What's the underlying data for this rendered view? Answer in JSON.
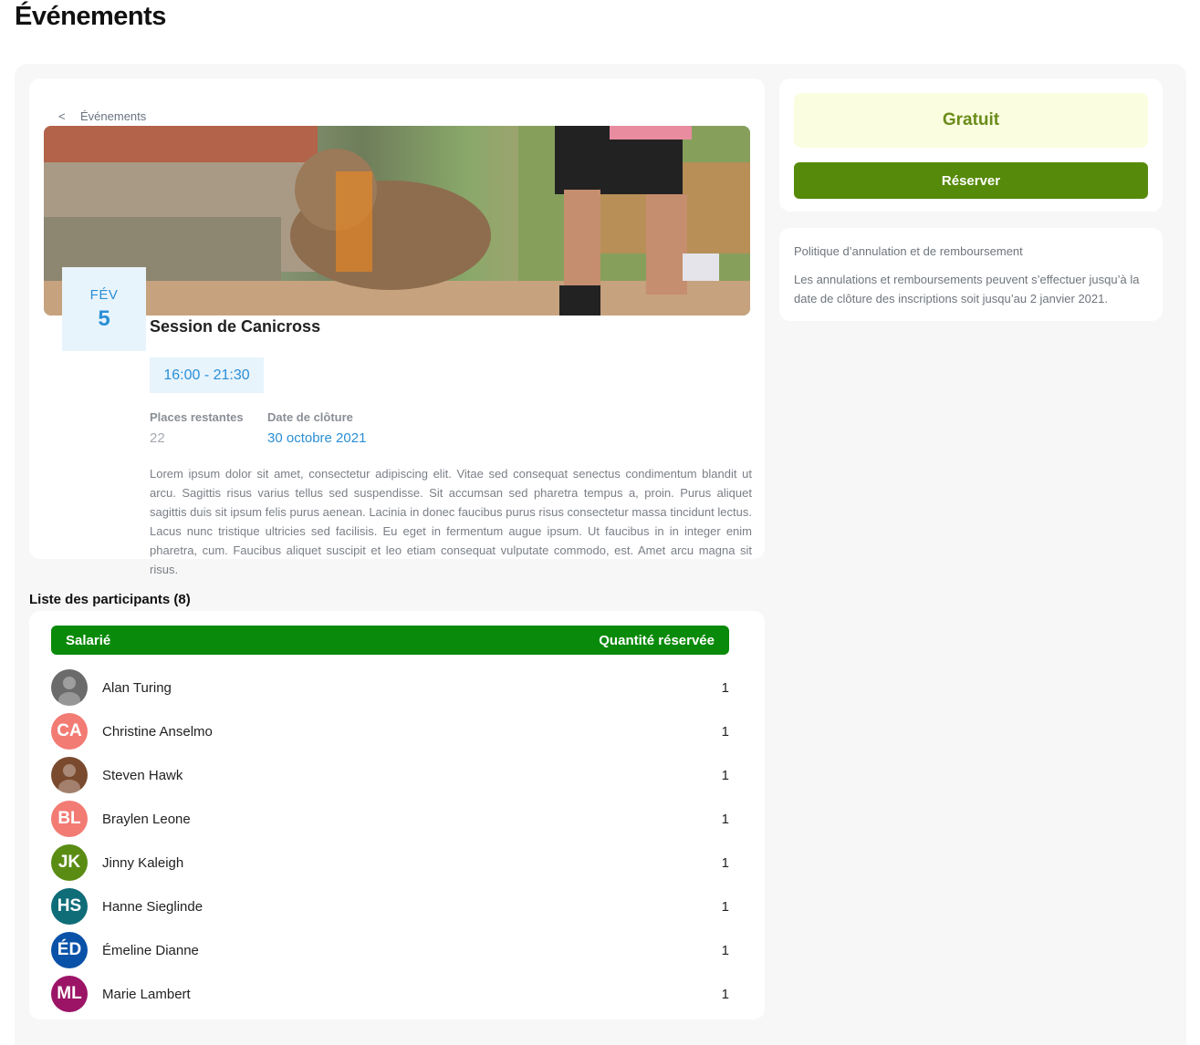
{
  "page": {
    "title": "Événements"
  },
  "breadcrumb": {
    "back_label": "Événements"
  },
  "event": {
    "date_month": "FÉV",
    "date_day": "5",
    "title": "Session de Canicross",
    "time": "16:00 - 21:30",
    "places_label": "Places restantes",
    "places_value": "22",
    "closing_label": "Date de clôture",
    "closing_value": "30 octobre 2021",
    "description": "Lorem ipsum dolor sit amet, consectetur adipiscing elit. Vitae sed consequat senectus condimentum blandit ut arcu. Sagittis risus varius tellus sed suspendisse. Sit accumsan sed pharetra tempus a, proin. Purus aliquet sagittis duis sit ipsum felis purus aenean. Lacinia in donec faucibus purus risus consectetur massa tincidunt lectus. Lacus nunc tristique ultricies sed facilisis. Eu eget in fermentum augue ipsum. Ut faucibus in in integer enim pharetra, cum. Faucibus aliquet suscipit et leo etiam consequat vulputate commodo, est. Amet arcu magna sit risus."
  },
  "participants": {
    "heading": "Liste des participants (8)",
    "col_employee": "Salarié",
    "col_quantity": "Quantité réservée",
    "rows": [
      {
        "name": "Alan Turing",
        "initials": "",
        "color": "#6b6b6b",
        "photo": true,
        "quantity": "1"
      },
      {
        "name": "Christine Anselmo",
        "initials": "CA",
        "color": "#f27b74",
        "photo": false,
        "quantity": "1"
      },
      {
        "name": "Steven Hawk",
        "initials": "",
        "color": "#7a4a2e",
        "photo": true,
        "quantity": "1"
      },
      {
        "name": "Braylen Leone",
        "initials": "BL",
        "color": "#f27b74",
        "photo": false,
        "quantity": "1"
      },
      {
        "name": "Jinny Kaleigh",
        "initials": "JK",
        "color": "#5a8c14",
        "photo": false,
        "quantity": "1"
      },
      {
        "name": "Hanne Sieglinde",
        "initials": "HS",
        "color": "#0f6d78",
        "photo": false,
        "quantity": "1"
      },
      {
        "name": "Émeline Dianne",
        "initials": "ÉD",
        "color": "#0a52a8",
        "photo": false,
        "quantity": "1"
      },
      {
        "name": "Marie Lambert",
        "initials": "ML",
        "color": "#9c1466",
        "photo": false,
        "quantity": "1"
      }
    ]
  },
  "pricing": {
    "price_label": "Gratuit",
    "reserve_label": "Réserver"
  },
  "policy": {
    "title": "Politique d’annulation et de remboursement",
    "text": "Les annulations et remboursements peuvent s’effectuer jusqu’à la date de clôture des inscriptions soit jusqu’au 2 janvier 2021."
  },
  "colors": {
    "accent_blue": "#2a8fd6",
    "table_header_green": "#0a8a0a",
    "reserve_green": "#568a0a",
    "price_text": "#6a8c1a"
  }
}
